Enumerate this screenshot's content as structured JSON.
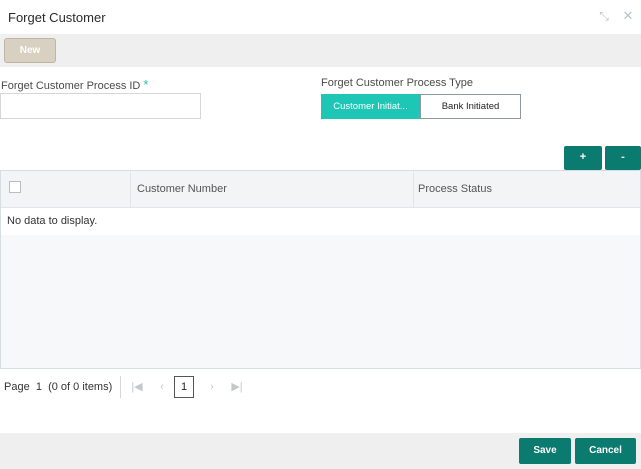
{
  "window": {
    "title": "Forget Customer",
    "minimize_icon": "collapse-arrows-icon",
    "close_icon": "close-icon"
  },
  "toolbar": {
    "new_label": "New"
  },
  "form": {
    "process_id_label": "Forget Customer Process ID",
    "required_mark": "*",
    "process_id_value": "",
    "process_type_label": "Forget Customer Process Type",
    "process_type_options": [
      "Customer Initiat...",
      "Bank Initiated"
    ],
    "process_type_selected": "Customer Initiat..."
  },
  "grid": {
    "add_label": "+",
    "remove_label": "-",
    "columns": [
      "Customer Number",
      "Process Status"
    ],
    "rows": [],
    "empty_message": "No data to display."
  },
  "pagination": {
    "page_label": "Page",
    "current_page": "1",
    "items_summary": "(0 of 0 items)",
    "page_button": "1"
  },
  "footer": {
    "save_label": "Save",
    "cancel_label": "Cancel"
  },
  "colors": {
    "accent_teal": "#1ec6b6",
    "button_dark_teal": "#0b7a6f",
    "new_button": "#d8d0c0"
  }
}
